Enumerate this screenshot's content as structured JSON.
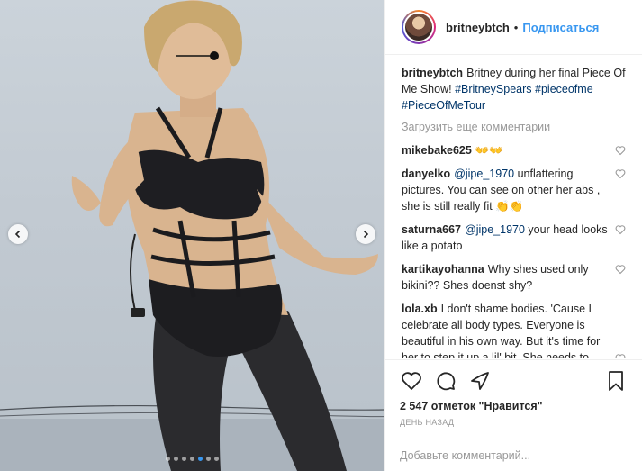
{
  "post": {
    "username": "britneybtch",
    "separator": "•",
    "follow_label": "Подписаться",
    "caption": {
      "username": "britneybtch",
      "text_parts": [
        "Britney during her final Piece Of Me Show! ",
        "#BritneySpears",
        " ",
        "#pieceofme",
        " ",
        "#PieceOfMeTour"
      ]
    },
    "load_more_label": "Загрузить еще комментарии",
    "comments": [
      {
        "username": "mikebake625",
        "text": "👐👐"
      },
      {
        "username": "danyelko",
        "mention": "@jipe_1970",
        "text": " unflattering pictures. You can see on other her abs , she is still really fit 👏👏"
      },
      {
        "username": "saturna667",
        "mention": "@jipe_1970",
        "text": " your head looks like a potato"
      },
      {
        "username": "kartikayohanna",
        "text": "Why shes used only bikini?? Shes doenst shy?"
      },
      {
        "username": "lola.xb",
        "text": "I don't shame bodies. 'Cause I celebrate all body types. Everyone is beautiful in his own way. But it's time for her to step it up a lil' bit. She needs to start dressing for her body type & her age. Hire a new glam squad. She is"
      }
    ],
    "likes_text": "2 547 отметок \"Нравится\"",
    "time_text": "день назад",
    "add_comment_placeholder": "Добавьте комментарий...",
    "carousel": {
      "slide_count": 7,
      "active_index": 4
    }
  },
  "icons": {
    "like": "heart-icon",
    "comment": "comment-icon",
    "share": "share-icon",
    "save": "bookmark-icon",
    "prev": "chevron-left-icon",
    "next": "chevron-right-icon"
  },
  "colors": {
    "accent": "#3897f0",
    "mention": "#003569",
    "muted": "#999999"
  }
}
